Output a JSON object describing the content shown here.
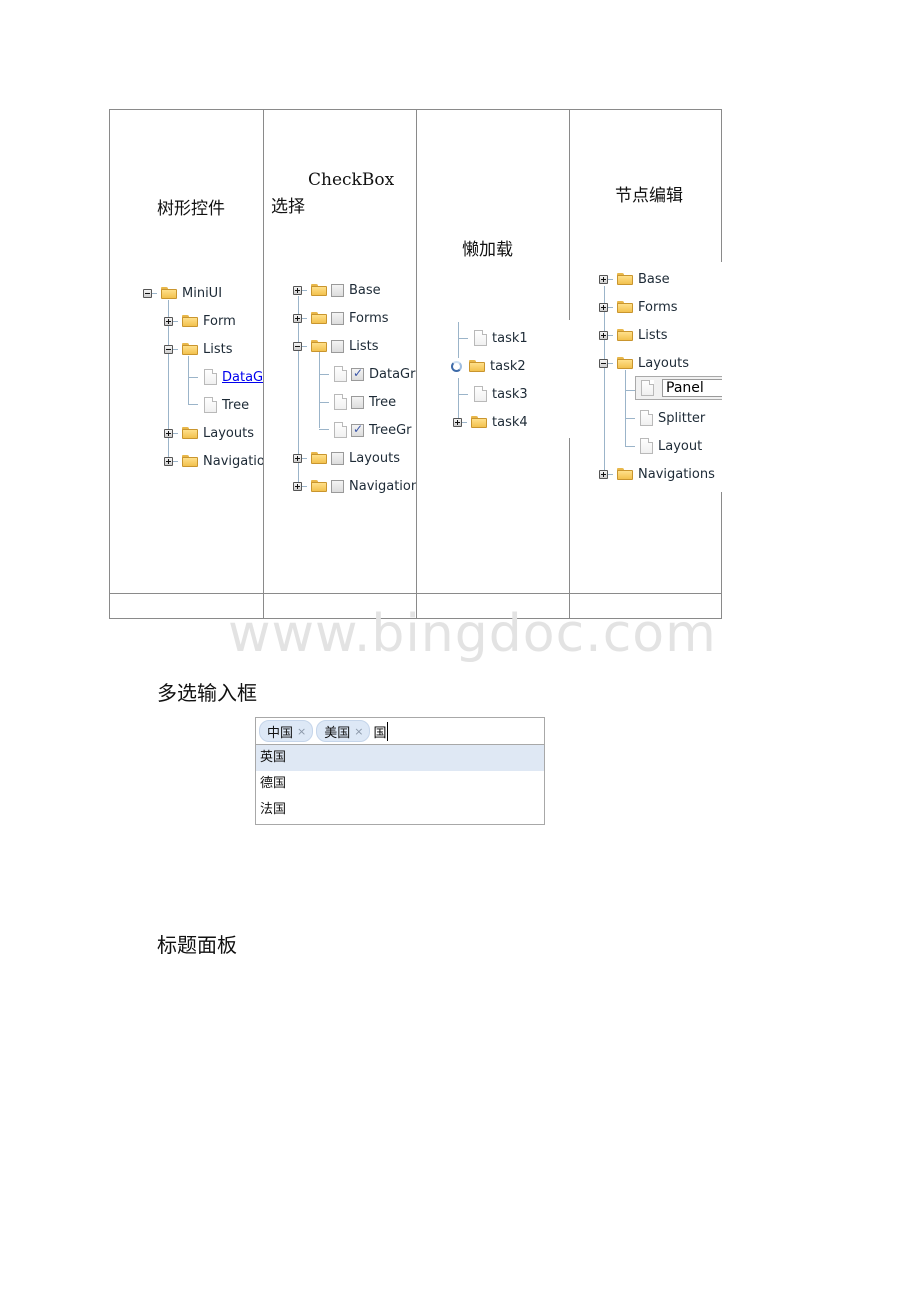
{
  "table": {
    "columns": [
      {
        "caption": "树形控件"
      },
      {
        "caption_line1": "CheckBox",
        "caption_line2": "选择"
      },
      {
        "caption": "懒加载"
      },
      {
        "caption": "节点编辑"
      }
    ]
  },
  "tree_basic": {
    "root": {
      "label": "MiniUI",
      "expanded": true
    },
    "nodes": [
      {
        "label": "Form",
        "type": "folder",
        "expanded": false
      },
      {
        "label": "Lists",
        "type": "folder",
        "expanded": true
      },
      {
        "label": "DataG",
        "type": "file",
        "link": true
      },
      {
        "label": "Tree",
        "type": "file"
      },
      {
        "label": "Layouts",
        "type": "folder",
        "expanded": false
      },
      {
        "label": "Navigatio",
        "type": "folder",
        "expanded": false
      }
    ]
  },
  "tree_checkbox": {
    "nodes": [
      {
        "label": "Base",
        "checked": false
      },
      {
        "label": "Forms",
        "checked": false
      },
      {
        "label": "Lists",
        "checked": false
      },
      {
        "label": "DataGr",
        "checked": true
      },
      {
        "label": "Tree",
        "checked": false
      },
      {
        "label": "TreeGr",
        "checked": true
      },
      {
        "label": "Layouts",
        "checked": false
      },
      {
        "label": "Navigation",
        "checked": false
      }
    ]
  },
  "tree_lazy": {
    "nodes": [
      {
        "label": "task1",
        "type": "file"
      },
      {
        "label": "task2",
        "type": "folder",
        "state": "loading"
      },
      {
        "label": "task3",
        "type": "file"
      },
      {
        "label": "task4",
        "type": "folder",
        "expanded": false
      }
    ]
  },
  "tree_edit": {
    "nodes": [
      {
        "label": "Base"
      },
      {
        "label": "Forms"
      },
      {
        "label": "Lists"
      },
      {
        "label": "Layouts"
      },
      {
        "label": "Panel",
        "editing": true
      },
      {
        "label": "Splitter"
      },
      {
        "label": "Layout"
      },
      {
        "label": "Navigations"
      }
    ]
  },
  "watermark": "www.bingdoc.com",
  "sections": {
    "multiselect_title": "多选输入框",
    "titlepanel_title": "标题面板"
  },
  "multiselect": {
    "tags": [
      "中国",
      "美国"
    ],
    "tag_remove_icon": "×",
    "input_value": "国",
    "options": [
      "英国",
      "德国",
      "法国"
    ],
    "highlighted_index": 0
  }
}
